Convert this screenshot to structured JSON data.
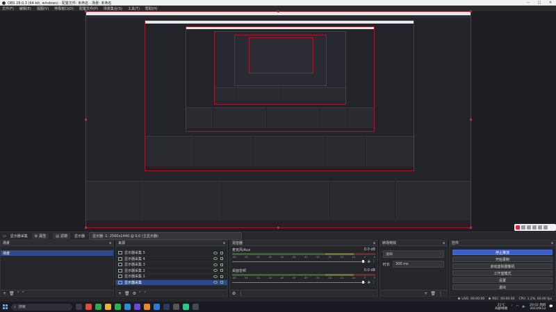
{
  "window": {
    "title": "OBS 28.0.3 (64-bit, windows) - 配置文件: 未命名 - 场景: 未命名"
  },
  "menu": [
    "文件(F)",
    "编辑(E)",
    "视图(V)",
    "停靠窗口(D)",
    "配置文件(P)",
    "场景集合(S)",
    "工具(T)",
    "帮助(H)"
  ],
  "scene_toolbar": {
    "source_label": "显示器采集",
    "properties_label": "属性",
    "filters_label": "滤镜",
    "display_label": "显示器",
    "display_value": "显示器: 1: 2560x1440 @ 0,0 (主显示器)"
  },
  "scenes": {
    "title": "场景",
    "items": [
      "场景"
    ]
  },
  "sources": {
    "title": "来源",
    "items": [
      "显示器采集 5",
      "显示器采集 4",
      "显示器采集 3",
      "显示器采集 2",
      "显示器采集 1",
      "显示器采集"
    ]
  },
  "mixer": {
    "title": "混音器",
    "channels": [
      {
        "name": "麦克风/Aux",
        "db": "0.0 dB"
      },
      {
        "name": "桌面音频",
        "db": "0.0 dB"
      }
    ],
    "scale": [
      "-60",
      "-55",
      "-50",
      "-45",
      "-40",
      "-35",
      "-30",
      "-25",
      "-20",
      "-15",
      "-10",
      "-5",
      "0"
    ]
  },
  "transitions": {
    "title": "转场特效",
    "type": "淡出",
    "duration_label": "时长",
    "duration_value": "300 ms"
  },
  "controls": {
    "title": "控件",
    "buttons": [
      "停止推流",
      "开始录制",
      "启动虚拟摄像机",
      "工作室模式",
      "设置",
      "退出"
    ],
    "active_index": 0
  },
  "statusbar": {
    "live": "LIVE: 00:00:00",
    "rec": "REC: 00:00:00",
    "cpu": "CPU: 1.2%, 60.00 fps"
  },
  "taskbar": {
    "search_placeholder": "搜索",
    "weather_temp": "21℃",
    "weather_desc": "局部晴朗",
    "time": "20:02 周四",
    "date": "2023/9/12"
  },
  "colors": {
    "accent": "#3b5fc8",
    "selection": "#2f4a8a",
    "preview_border": "#a11a2a"
  }
}
